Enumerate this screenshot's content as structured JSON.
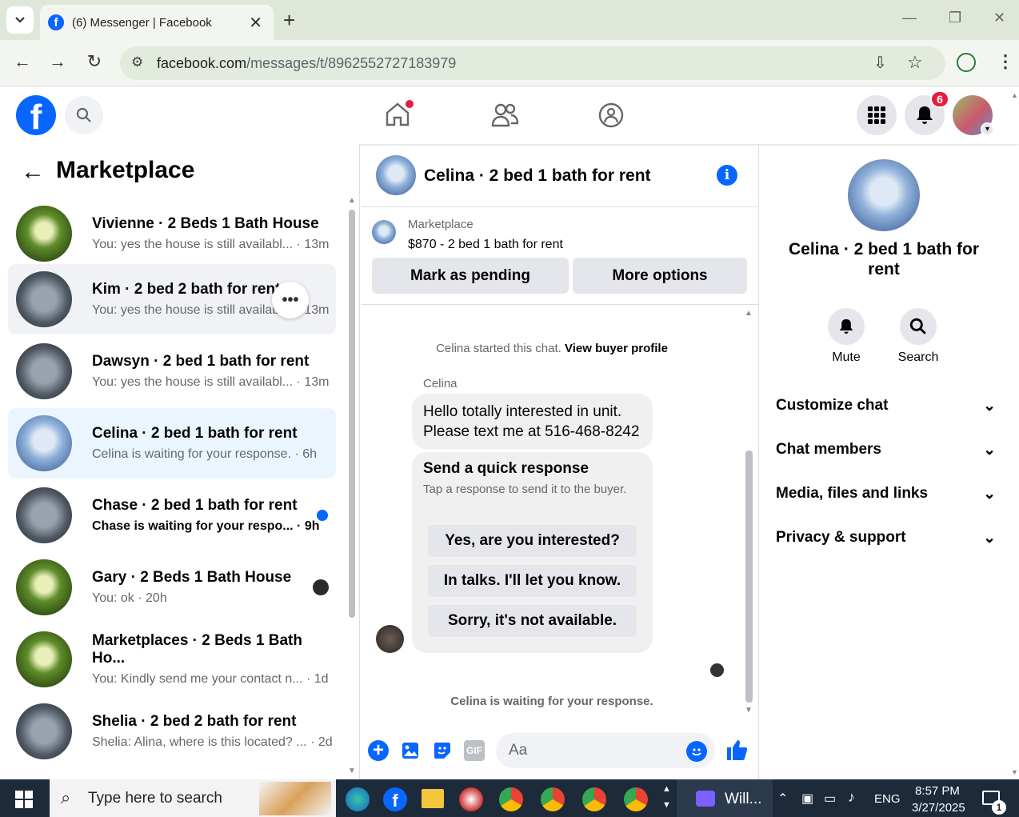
{
  "browser": {
    "tab_title": "(6) Messenger | Facebook",
    "url_host": "facebook.com",
    "url_path": "/messages/t/8962552727183979"
  },
  "header": {
    "notification_count": "6"
  },
  "left": {
    "title": "Marketplace",
    "conversations": [
      {
        "name": "Vivienne · 2 Beds 1 Bath House",
        "preview": "You: yes the house is still availabl...",
        "time": "13m"
      },
      {
        "name": "Kim · 2 bed 2 bath for rent",
        "preview": "You: yes the house is still availabl...",
        "time": "13m"
      },
      {
        "name": "Dawsyn · 2 bed 1 bath for rent",
        "preview": "You: yes the house is still availabl...",
        "time": "13m"
      },
      {
        "name": "Celina · 2 bed 1 bath for rent",
        "preview": "Celina is waiting for your response.",
        "time": "6h"
      },
      {
        "name": "Chase · 2 bed 1 bath for rent",
        "preview": "Chase is waiting for your respo...",
        "time": "9h"
      },
      {
        "name": "Gary · 2 Beds 1 Bath House",
        "preview": "You: ok",
        "time": "20h"
      },
      {
        "name": "Marketplaces · 2 Beds 1 Bath Ho...",
        "preview": "You: Kindly send me your contact n...",
        "time": "1d"
      },
      {
        "name": "Shelia · 2 bed 2 bath for rent",
        "preview": "Shelia: Alina, where is this located? ...",
        "time": "2d"
      }
    ]
  },
  "chat": {
    "title": "Celina · 2 bed 1 bath for rent",
    "listing_source": "Marketplace",
    "listing_price": "$870 - 2 bed 1 bath for rent",
    "mark_pending": "Mark as pending",
    "more_options": "More options",
    "started_text": "Celina started this chat.",
    "view_profile": "View buyer profile",
    "sender": "Celina",
    "message_line1": "Hello totally interested in unit.",
    "message_line2": "Please text me at 516-468-8242",
    "quick_title": "Send a quick response",
    "quick_sub": "Tap a response to send it to the buyer.",
    "quick_options": [
      "Yes, are you interested?",
      "In talks. I'll let you know.",
      "Sorry, it's not available."
    ],
    "waiting": "Celina is waiting for your response.",
    "composer_placeholder": "Aa"
  },
  "right": {
    "title": "Celina · 2 bed 1 bath for rent",
    "mute": "Mute",
    "search": "Search",
    "sections": [
      "Customize chat",
      "Chat members",
      "Media, files and links",
      "Privacy & support"
    ]
  },
  "taskbar": {
    "search_placeholder": "Type here to search",
    "app_label": "Will...",
    "lang": "ENG",
    "time": "8:57 PM",
    "date": "3/27/2025",
    "notif_count": "1"
  }
}
